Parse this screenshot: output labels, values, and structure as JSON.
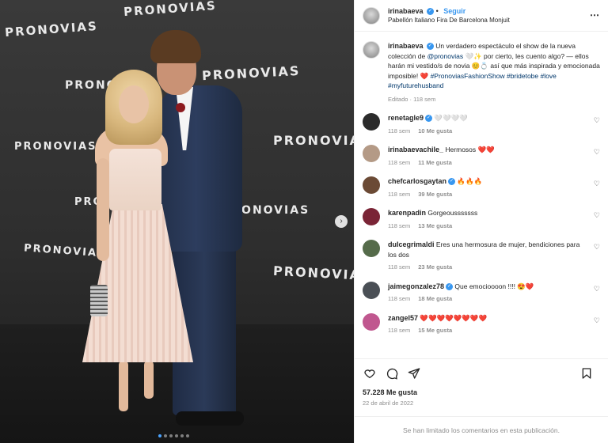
{
  "post": {
    "author": "irinabaeva",
    "follow_label": "Seguir",
    "location": "Pabellón Italiano Fira De Barcelona Monjuit",
    "more_icon": "more-horizontal-icon",
    "photo_watermark": "PRONOVIAS",
    "carousel": {
      "current": 1,
      "total": 6
    }
  },
  "caption": {
    "author": "irinabaeva",
    "text_1": " Un verdadero espectáculo el show de la nueva colección de ",
    "mention": "@pronovias",
    "text_2": " 🤍✨ por cierto, les cuento algo? — ellos harán mi vestido/s de novia 😊💍 así que más inspirada y emocionada imposible! ❤️ ",
    "hashtags": "#PronoviasFashionShow #bridetobe #love #myfuturehusband",
    "edited": "Editado",
    "time": "118 sem"
  },
  "comments": [
    {
      "user": "renetagle9",
      "verified": true,
      "text": "🤍🤍🤍🤍",
      "time": "118 sem",
      "likes": "10 Me gusta",
      "avatar_color": "#2b2b2b"
    },
    {
      "user": "irinabaevachile_",
      "verified": false,
      "text": "Hermosos ❤️❤️",
      "time": "118 sem",
      "likes": "11 Me gusta",
      "avatar_color": "#b49a86"
    },
    {
      "user": "chefcarlosgaytan",
      "verified": true,
      "text": "🔥🔥🔥",
      "time": "118 sem",
      "likes": "39 Me gusta",
      "avatar_color": "#6b4a35"
    },
    {
      "user": "karenpadin",
      "verified": false,
      "text": "Gorgeousssssss",
      "time": "118 sem",
      "likes": "13 Me gusta",
      "avatar_color": "#7a2436"
    },
    {
      "user": "dulcegrimaldi",
      "verified": false,
      "text": "Eres una hermosura de mujer, bendiciones para los dos",
      "time": "118 sem",
      "likes": "23 Me gusta",
      "avatar_color": "#556b4a"
    },
    {
      "user": "jaimegonzalez78",
      "verified": true,
      "text": "Que emocioooon !!!! 😍❤️",
      "time": "118 sem",
      "likes": "18 Me gusta",
      "avatar_color": "#4a4f55"
    },
    {
      "user": "zangel57",
      "verified": false,
      "text": "❤️❤️❤️❤️❤️❤️❤️❤️",
      "time": "118 sem",
      "likes": "15 Me gusta",
      "avatar_color": "#c0578f"
    }
  ],
  "actions": {
    "like_icon": "heart-icon",
    "comment_icon": "comment-icon",
    "share_icon": "share-icon",
    "save_icon": "bookmark-icon"
  },
  "stats": {
    "likes": "57.228 Me gusta",
    "date": "22 de abril de 2022"
  },
  "footer": {
    "limited_comments": "Se han limitado los comentarios en esta publicación."
  }
}
